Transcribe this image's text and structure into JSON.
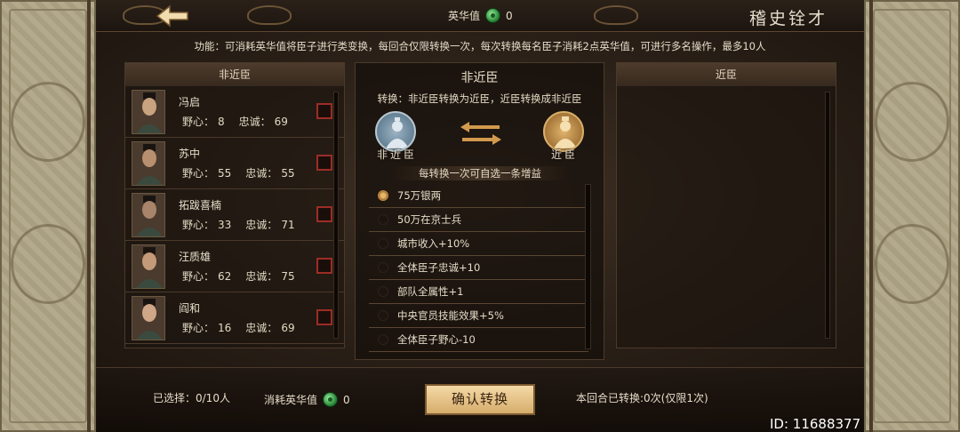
{
  "header": {
    "title": "稽史铨才",
    "resource_label": "英华值",
    "resource_value": "0"
  },
  "description": "功能：可消耗英华值将臣子进行类变换，每回合仅限转换一次，每次转换每名臣子消耗2点英华值，可进行多名操作，最多10人",
  "left_panel": {
    "title": "非近臣",
    "ambition_label": "野心：",
    "loyalty_label": "忠诚：",
    "officers": [
      {
        "name": "冯启",
        "ambition": "8",
        "loyalty": "69"
      },
      {
        "name": "苏中",
        "ambition": "55",
        "loyalty": "55"
      },
      {
        "name": "拓跋喜楠",
        "ambition": "33",
        "loyalty": "71"
      },
      {
        "name": "汪质雄",
        "ambition": "62",
        "loyalty": "75"
      },
      {
        "name": "阎和",
        "ambition": "16",
        "loyalty": "69"
      }
    ]
  },
  "right_panel": {
    "title": "近臣"
  },
  "center": {
    "title": "非近臣",
    "subtitle": "转换：非近臣转换为近臣，近臣转换成非近臣",
    "left_label": "非近臣",
    "right_label": "近臣",
    "hint": "每转换一次可自选一条增益",
    "options": [
      {
        "label": "75万银两",
        "selected": true
      },
      {
        "label": "50万在京士兵",
        "selected": false
      },
      {
        "label": "城市收入+10%",
        "selected": false
      },
      {
        "label": "全体臣子忠诚+10",
        "selected": false
      },
      {
        "label": "部队全属性+1",
        "selected": false
      },
      {
        "label": "中央官员技能效果+5%",
        "selected": false
      },
      {
        "label": "全体臣子野心-10",
        "selected": false
      }
    ]
  },
  "footer": {
    "selected": "已选择：0/10人",
    "cost_label": "消耗英华值",
    "cost_value": "0",
    "confirm_label": "确认转换",
    "turn_status": "本回合已转换:0次(仅限1次)",
    "uid": "ID: 11688377"
  },
  "colors": {
    "accent": "#e6b86a",
    "checkbox_border": "#9c2d26",
    "confirm_bg": "#f4d9a6"
  }
}
